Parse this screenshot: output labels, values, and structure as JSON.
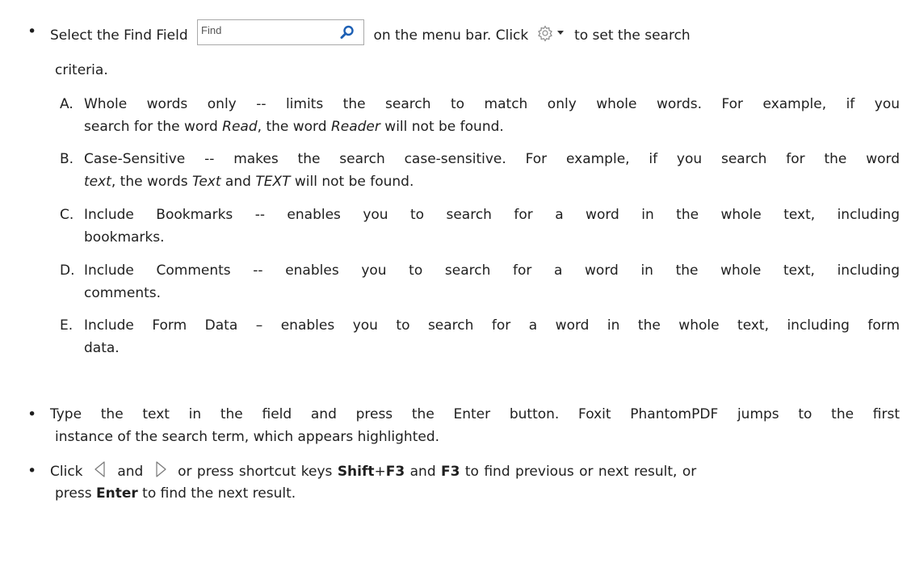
{
  "bullet_char": "•",
  "p1": {
    "before_field": "Select the Find Field",
    "field_placeholder": "Find",
    "between": "on the menu bar. Click",
    "after_gear": "to set the search",
    "line2": "criteria."
  },
  "options": [
    {
      "marker": "A.",
      "label": "Whole words only",
      "line1_rest": " -- limits the search to match only whole words. For example, if you",
      "line2_a": "search for the word ",
      "line2_i1": "Read",
      "line2_b": ", the word ",
      "line2_i2": "Reader",
      "line2_c": " will not be found."
    },
    {
      "marker": "B.",
      "label": "Case-Sensitive",
      "line1_rest": " -- makes the search case-sensitive. For example, if you search for the word",
      "line2_i1": "text",
      "line2_a": ", the words ",
      "line2_i2": "Text",
      "line2_b": " and ",
      "line2_i3": "TEXT",
      "line2_c": " will not be found."
    },
    {
      "marker": "C.",
      "label": "Include Bookmarks",
      "line1_rest": " -- enables you to search for a word in the whole text, including",
      "line2": "bookmarks."
    },
    {
      "marker": "D.",
      "label": "Include Comments",
      "line1_rest": " -- enables you to search for a word in the whole text, including",
      "line2": "comments."
    },
    {
      "marker": "E.",
      "label": "Include Form Data",
      "line1_rest": " – enables you to search for a word in the whole text, including form",
      "line2": "data."
    }
  ],
  "p2": {
    "line1": "Type the text in the field and press the Enter button. Foxit PhantomPDF jumps to the first",
    "line2": "instance of the search term, which appears highlighted."
  },
  "p3": {
    "click": "Click",
    "and": "and",
    "or_press": "or press shortcut keys",
    "shift": "Shift",
    "plus": "+",
    "f3a": "F3",
    "and2": "and",
    "f3b": "F3",
    "rest": "to find previous or next result, or",
    "line2_a": "press ",
    "enter": "Enter",
    "line2_b": " to find the next result."
  },
  "icons": {
    "find_field": "search-icon",
    "gear": "gear-icon",
    "prev": "previous-result-icon",
    "next": "next-result-icon"
  },
  "colors": {
    "search_icon": "#1c5fb4",
    "text": "#1f1f1f"
  }
}
